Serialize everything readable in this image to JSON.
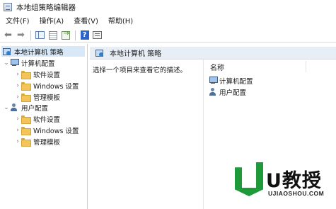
{
  "window": {
    "title": "本地组策略编辑器"
  },
  "menu": [
    "文件(F)",
    "操作(A)",
    "查看(V)",
    "帮助(H)"
  ],
  "toolbar": {
    "buttons": [
      "back-arrow-icon",
      "forward-arrow-icon",
      "show-hide-tree-icon",
      "properties-list-icon",
      "export-list-icon",
      "help-icon",
      "view-icon"
    ]
  },
  "tree": {
    "root": "本地计算机 策略",
    "computer": {
      "label": "计算机配置",
      "children": [
        "软件设置",
        "Windows 设置",
        "管理模板"
      ]
    },
    "user": {
      "label": "用户配置",
      "children": [
        "软件设置",
        "Windows 设置",
        "管理模板"
      ]
    }
  },
  "details": {
    "header_title": "本地计算机 策略",
    "description": "选择一个项目来查看它的描述。",
    "column_name": "名称",
    "items": [
      "计算机配置",
      "用户配置"
    ]
  },
  "watermark": {
    "brand": "U教授",
    "url": "UJIAOSHOU.COM",
    "color": "#1f9a3b"
  },
  "colors": {
    "selection": "#d9e8f7",
    "header_bg": "#e8eef6"
  }
}
